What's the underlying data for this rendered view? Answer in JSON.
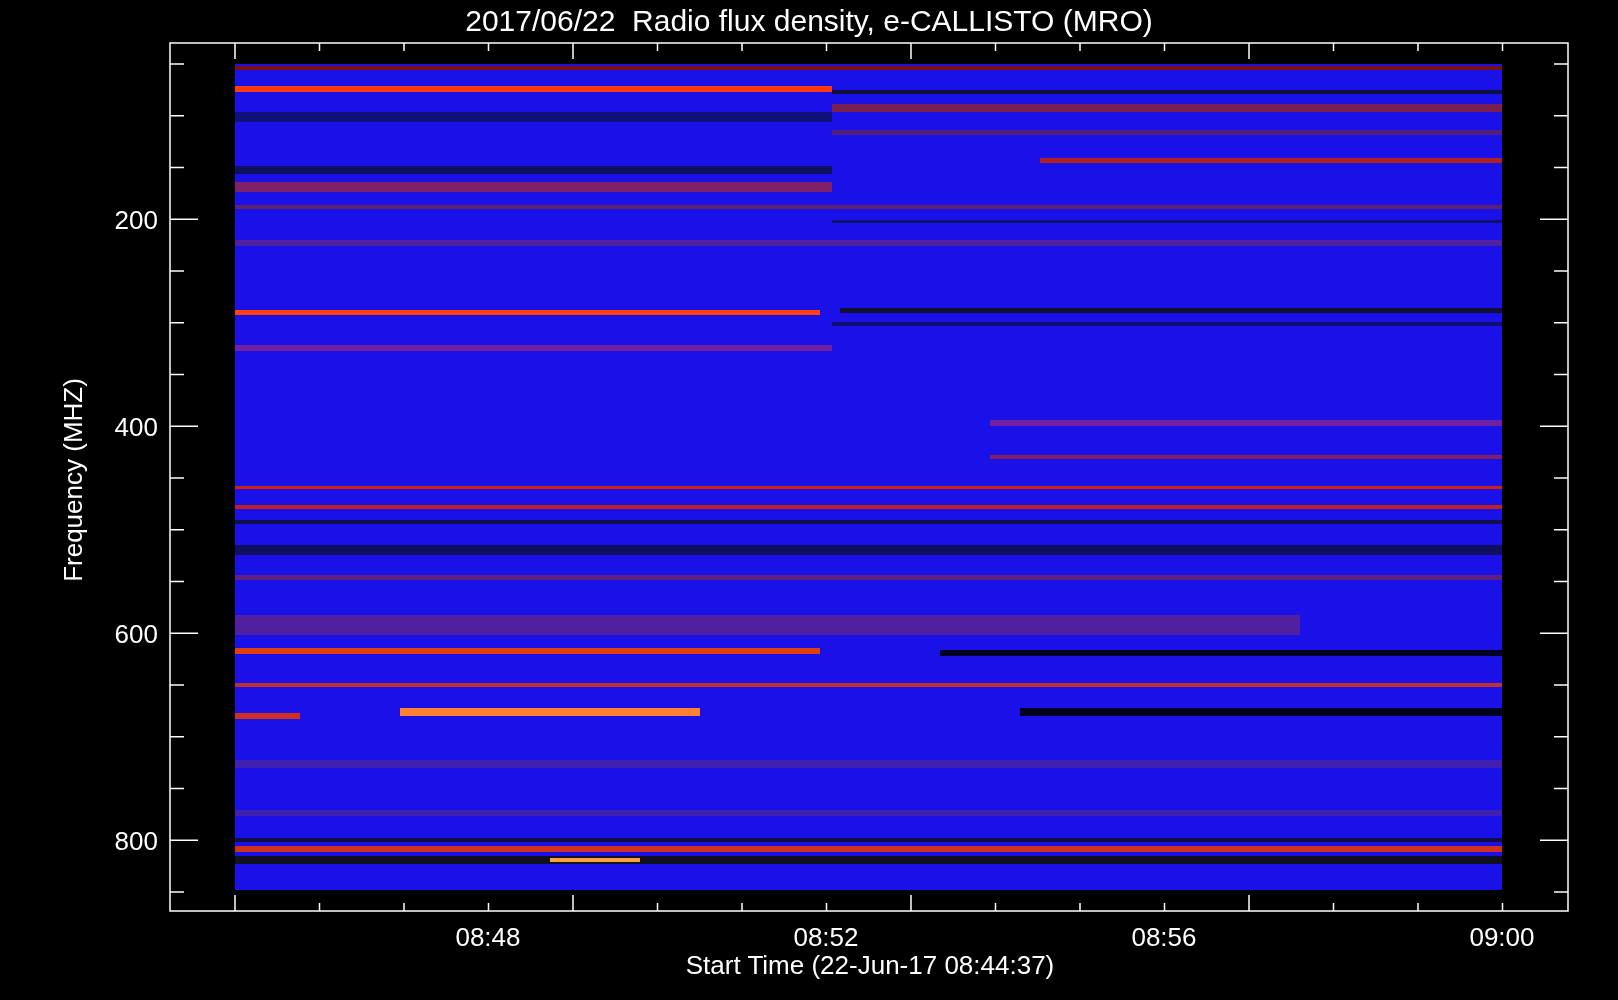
{
  "title": "2017/06/22  Radio flux density, e-CALLISTO (MRO)",
  "y_axis": {
    "label": "Frequency (MHZ)",
    "ticks": [
      "200",
      "400",
      "600",
      "800"
    ]
  },
  "x_axis": {
    "label": "Start Time (22-Jun-17 08:44:37)",
    "ticks": [
      "08:48",
      "08:52",
      "08:56",
      "09:00"
    ]
  }
}
